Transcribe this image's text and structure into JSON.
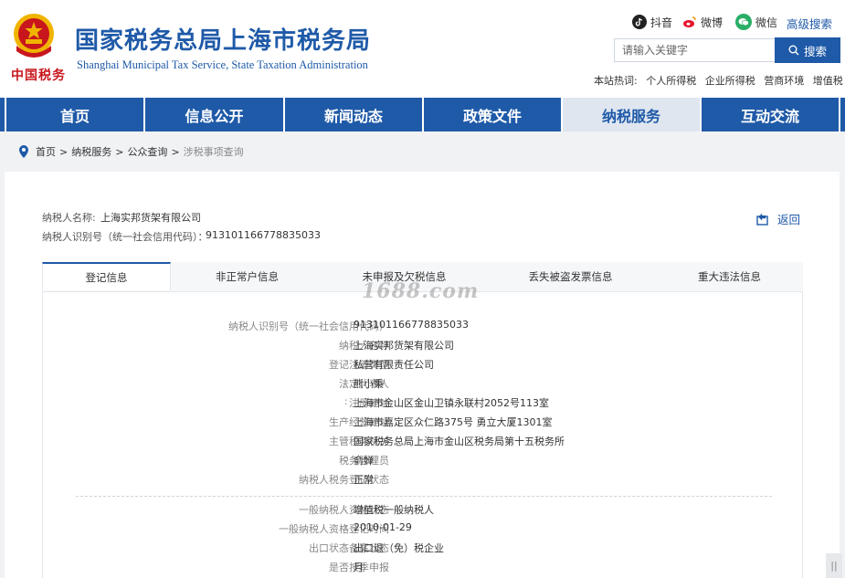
{
  "header": {
    "title": "国家税务总局上海市税务局",
    "subtitle": "Shanghai Municipal Tax Service, State Taxation Administration",
    "logo_script": "中国税务",
    "social": [
      {
        "label": "抖音",
        "icon": "douyin-icon",
        "color": "#222222"
      },
      {
        "label": "微博",
        "icon": "weibo-icon",
        "color": "#e6162d"
      },
      {
        "label": "微信",
        "icon": "wechat-icon",
        "color": "#2aae67"
      }
    ],
    "advanced_search": "高级搜索",
    "search": {
      "placeholder": "请输入关键字",
      "button": "搜索"
    },
    "hot_label": "本站热词:",
    "hot_words": [
      "个人所得税",
      "企业所得税",
      "营商环境",
      "增值税"
    ]
  },
  "nav": {
    "items": [
      "首页",
      "信息公开",
      "新闻动态",
      "政策文件",
      "纳税服务",
      "互动交流"
    ],
    "active": "纳税服务"
  },
  "breadcrumb": {
    "items": [
      "首页",
      "纳税服务",
      "公众查询"
    ],
    "current": "涉税事项查询"
  },
  "taxpayer": {
    "name_label": "纳税人名称:",
    "name": "上海实邦货架有限公司",
    "id_label": "纳税人识别号（统一社会信用代码）：",
    "id": "913101166778835033",
    "back": "返回"
  },
  "tabs": [
    "登记信息",
    "非正常户信息",
    "未申报及欠税信息",
    "丢失被盗发票信息",
    "重大违法信息"
  ],
  "active_tab": "登记信息",
  "details": [
    {
      "label": "纳税人识别号（统一社会信用代码）",
      "value": "913101166778835033"
    },
    {
      "label": "纳税人名称",
      "value": "上海实邦货架有限公司"
    },
    {
      "label": "登记注册类型",
      "value": "私营有限责任公司"
    },
    {
      "label": "法定代表人",
      "value": "熊小秉"
    },
    {
      "label": "注册地址",
      "value": "上海市金山区金山卫镇永联村2052号113室"
    },
    {
      "label": "生产经营地址",
      "value": "上海市嘉定区众仁路375号 勇立大厦1301室"
    },
    {
      "label": "主管税务机关",
      "value": "国家税务总局上海市金山区税务局第十五税务所"
    },
    {
      "label": "税务管理员",
      "value": "俞婵"
    },
    {
      "label": "纳税人税务登记状态",
      "value": "正常"
    }
  ],
  "details2": [
    {
      "label": "一般纳税人资格状态",
      "value": "增值税一般纳税人"
    },
    {
      "label": "一般纳税人资格登记时间",
      "value": "2010-01-29"
    },
    {
      "label": "出口状态备案状态",
      "value": "出口退（免）税企业"
    },
    {
      "label": "是否按季申报",
      "value": "月"
    }
  ],
  "watermark": "1688.com",
  "colors": {
    "brand": "#1f5aa8",
    "nav_active_bg": "#dfe6f0"
  }
}
